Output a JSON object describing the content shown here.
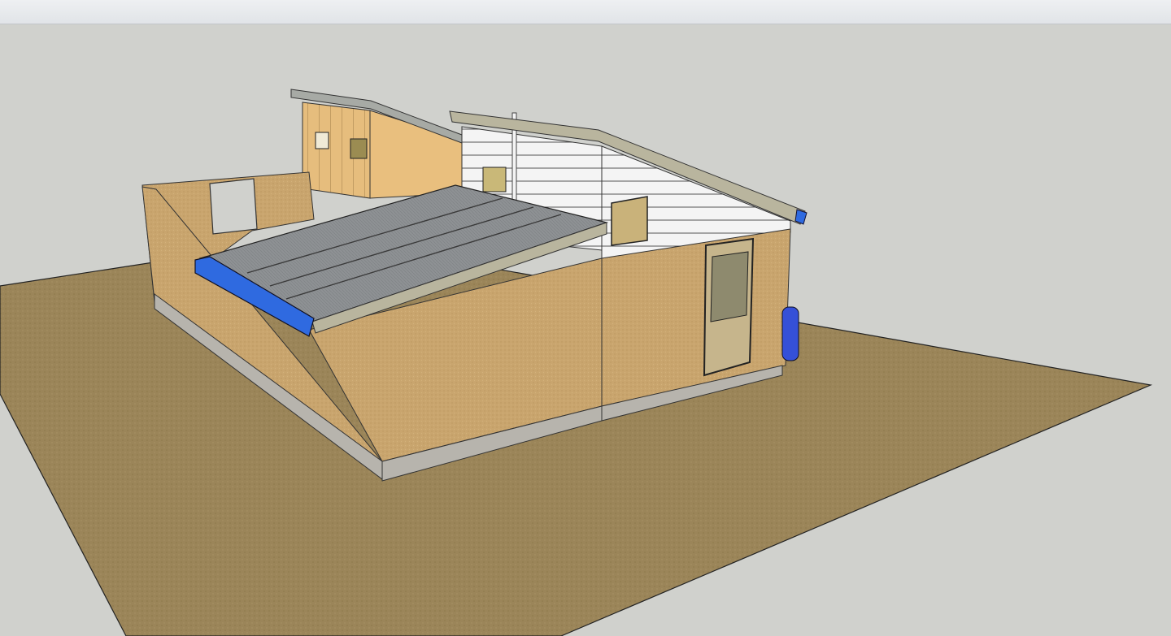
{
  "window": {
    "title": ""
  },
  "model": {
    "description_icon": "3d-house-model",
    "colors": {
      "background": "#d0d1cd",
      "ground": "#9a845a",
      "wall": "#c8a36c",
      "siding": "#f3f3f3",
      "roof": "#8f9295",
      "gutter": "#2f6ae0",
      "plinth": "#b8b5ae",
      "timber": "#e4b978"
    }
  }
}
